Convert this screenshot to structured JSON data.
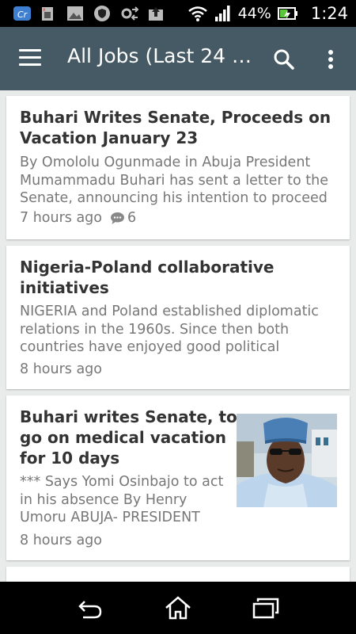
{
  "status_bar": {
    "battery_percent": "44%",
    "time": "1:24",
    "icons": [
      "app-icon",
      "sim-icon",
      "image-icon",
      "shield-icon",
      "settings-sync-icon",
      "upload-icon",
      "wifi-icon",
      "signal-icon",
      "battery-charging-icon"
    ]
  },
  "app_bar": {
    "title": "All Jobs (Last 24 Hours)",
    "icons": [
      "menu-icon",
      "search-icon",
      "more-vert-icon"
    ]
  },
  "articles": [
    {
      "title_lines": [
        "Buhari Writes Senate, Proceeds on",
        "Vacation January 23"
      ],
      "excerpt_lines": [
        "By Omololu Ogunmade in Abuja President",
        "Mumammadu Buhari has sent a letter to the",
        "Senate, announcing his intention to proceed"
      ],
      "time": "7 hours ago",
      "comments": "6"
    },
    {
      "title_lines": [
        "Nigeria-Poland collaborative",
        "initiatives"
      ],
      "excerpt_lines": [
        "NIGERIA and Poland established diplomatic",
        "relations in the 1960s. Since then both",
        "countries have enjoyed good political"
      ],
      "time": "8 hours ago"
    },
    {
      "title_lines": [
        "Buhari writes Senate, to",
        "go on medical vacation",
        "for 10 days"
      ],
      "excerpt_lines": [
        "*** Says Yomi Osinbajo to act",
        "in his absence By Henry",
        "Umoru ABUJA- PRESIDENT"
      ],
      "time": "8 hours ago",
      "has_thumbnail": true
    }
  ],
  "nav_bar": {
    "icons": [
      "back-icon",
      "home-icon",
      "recents-icon"
    ]
  }
}
